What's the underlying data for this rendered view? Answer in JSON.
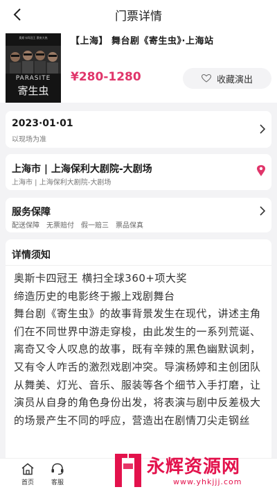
{
  "nav": {
    "title": "门票详情"
  },
  "poster": {
    "header_text": "奥斯卡四冠王 票房大热",
    "english": "PARASITE",
    "chinese": "寄生虫"
  },
  "event": {
    "name": "【上海】 舞台剧《寄生虫》·上海站",
    "price": "¥280-1280",
    "fav_label": "收藏演出"
  },
  "date_card": {
    "date": "2023·01·01",
    "note": "以现场为准"
  },
  "venue_card": {
    "title": "上海市 | 上海保利大剧院-大剧场",
    "subtitle": "上海市 | 上海保利大剧院-大剧场"
  },
  "service_card": {
    "title": "服务保障",
    "items": [
      "配送保障",
      "无票赔付",
      "假一赔三",
      "票品保真"
    ]
  },
  "details": {
    "heading": "详情须知",
    "lines": [
      "奥斯卡四冠王 横扫全球360+项大奖",
      "缔造历史的电影终于搬上戏剧舞台",
      "舞台剧《寄生虫》的故事背景发生在现代，讲述主角们在不同世界中游走穿梭，由此发生的一系列荒诞、离奇又令人叹息的故事，既有辛辣的黑色幽默讽刺，又有令人咋舌的激烈戏剧冲突。导演杨婷和主创团队从舞美、灯光、音乐、服装等各个细节入手打磨，让演员从自身的角色身份出发，将表演与剧中反差极大的场景产生不同的呼应，营造出在剧情刀尖走钢丝"
    ]
  },
  "tabbar": {
    "home": "首页",
    "service": "客服"
  },
  "watermark": {
    "text": "永辉资源网",
    "url": "www.yhkjjj.com"
  },
  "colors": {
    "accent": "#e0356a",
    "watermark": "#e3124c"
  }
}
